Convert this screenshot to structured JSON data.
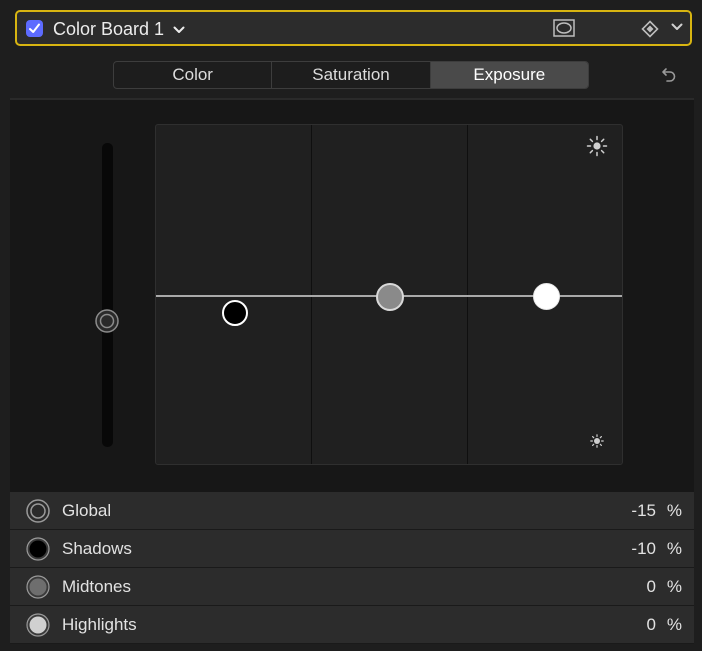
{
  "header": {
    "enabled": true,
    "title": "Color Board 1",
    "accent_color": "#d8b511",
    "checkbox_color": "#5d6bff",
    "icons": [
      "checkmark-icon",
      "chevron-down-icon",
      "mask-icon",
      "keyframe-icon",
      "chevron-down-icon"
    ]
  },
  "tabs": [
    {
      "label": "Color",
      "active": false
    },
    {
      "label": "Saturation",
      "active": false
    },
    {
      "label": "Exposure",
      "active": true
    }
  ],
  "reset_icon": "reset-icon",
  "board": {
    "icons": [
      "sun-large-icon",
      "sun-small-icon"
    ],
    "pucks": [
      {
        "name": "Global",
        "color": "#2a2a2a"
      },
      {
        "name": "Shadows",
        "color": "#000000"
      },
      {
        "name": "Midtones",
        "color": "#8a8a8a"
      },
      {
        "name": "Highlights",
        "color": "#ffffff"
      }
    ]
  },
  "rows": [
    {
      "label": "Global",
      "value": "-15",
      "unit": "%"
    },
    {
      "label": "Shadows",
      "value": "-10",
      "unit": "%"
    },
    {
      "label": "Midtones",
      "value": "0",
      "unit": "%"
    },
    {
      "label": "Highlights",
      "value": "0",
      "unit": "%"
    }
  ]
}
